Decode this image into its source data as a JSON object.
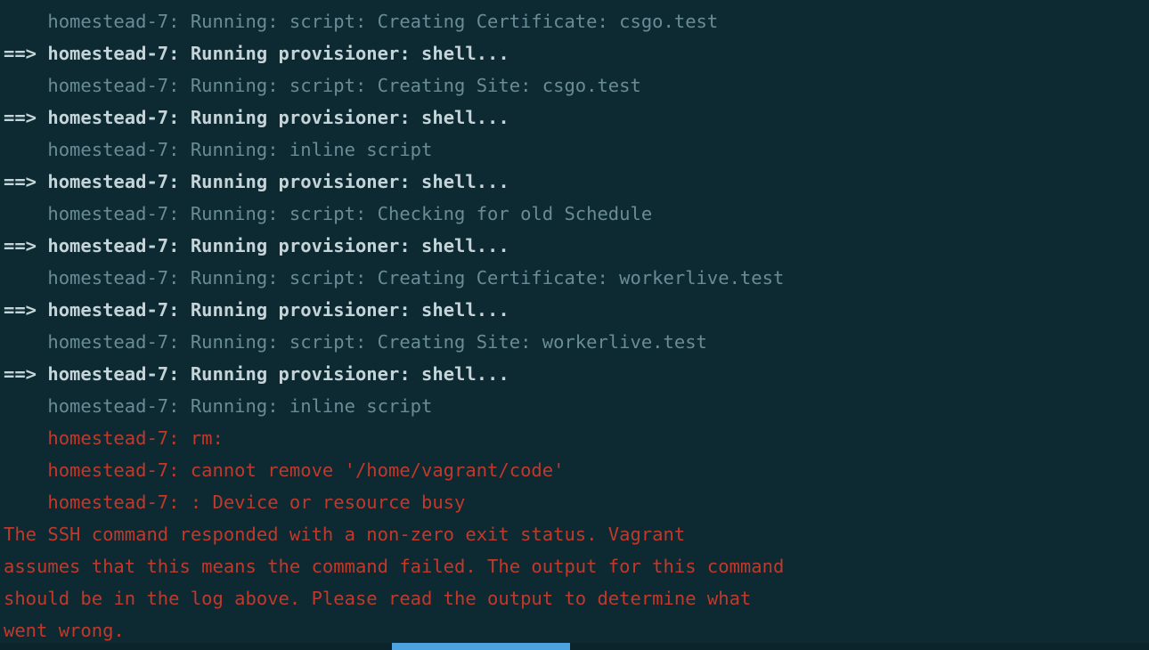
{
  "terminal": {
    "indent": "    ",
    "arrow": "==> ",
    "lines": [
      {
        "style": "dim",
        "indent": true,
        "text": "homestead-7: Running: script: Creating Certificate: csgo.test"
      },
      {
        "style": "hdr",
        "indent": false,
        "text": "homestead-7: Running provisioner: shell..."
      },
      {
        "style": "dim",
        "indent": true,
        "text": "homestead-7: Running: script: Creating Site: csgo.test"
      },
      {
        "style": "hdr",
        "indent": false,
        "text": "homestead-7: Running provisioner: shell..."
      },
      {
        "style": "dim",
        "indent": true,
        "text": "homestead-7: Running: inline script"
      },
      {
        "style": "hdr",
        "indent": false,
        "text": "homestead-7: Running provisioner: shell..."
      },
      {
        "style": "dim",
        "indent": true,
        "text": "homestead-7: Running: script: Checking for old Schedule"
      },
      {
        "style": "hdr",
        "indent": false,
        "text": "homestead-7: Running provisioner: shell..."
      },
      {
        "style": "dim",
        "indent": true,
        "text": "homestead-7: Running: script: Creating Certificate: workerlive.test"
      },
      {
        "style": "hdr",
        "indent": false,
        "text": "homestead-7: Running provisioner: shell..."
      },
      {
        "style": "dim",
        "indent": true,
        "text": "homestead-7: Running: script: Creating Site: workerlive.test"
      },
      {
        "style": "hdr",
        "indent": false,
        "text": "homestead-7: Running provisioner: shell..."
      },
      {
        "style": "dim",
        "indent": true,
        "text": "homestead-7: Running: inline script"
      },
      {
        "style": "err",
        "indent": true,
        "text": "homestead-7: rm: "
      },
      {
        "style": "err",
        "indent": true,
        "text": "homestead-7: cannot remove '/home/vagrant/code'"
      },
      {
        "style": "err",
        "indent": true,
        "text": "homestead-7: : Device or resource busy"
      },
      {
        "style": "err",
        "indent": false,
        "plain": true,
        "text": "The SSH command responded with a non-zero exit status. Vagrant"
      },
      {
        "style": "err",
        "indent": false,
        "plain": true,
        "text": "assumes that this means the command failed. The output for this command"
      },
      {
        "style": "err",
        "indent": false,
        "plain": true,
        "text": "should be in the log above. Please read the output to determine what"
      },
      {
        "style": "err",
        "indent": false,
        "plain": true,
        "text": "went wrong."
      }
    ]
  }
}
